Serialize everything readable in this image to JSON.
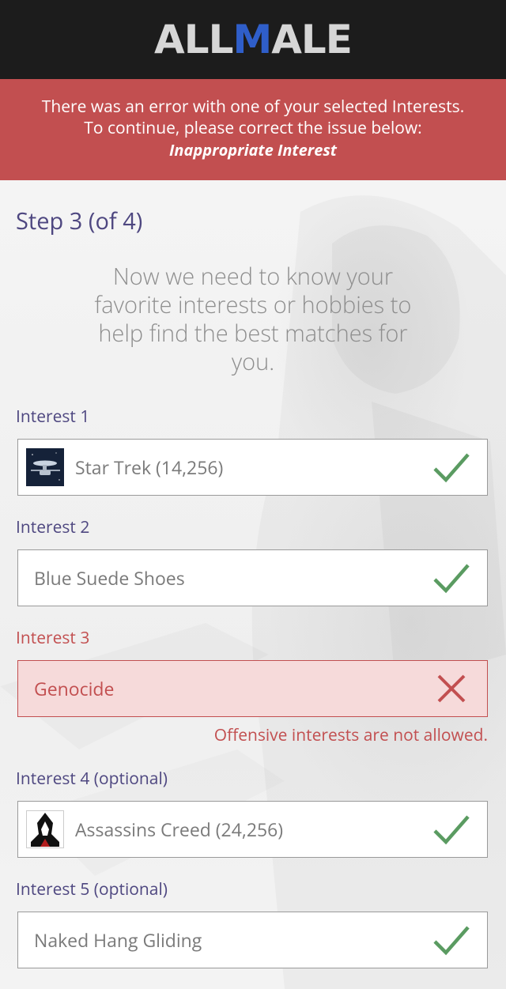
{
  "header": {
    "logo_part1": "ALL",
    "logo_part2": "M",
    "logo_part3": "ALE"
  },
  "error_banner": {
    "line1": "There was an error with one of your selected Interests.",
    "line2": "To continue, please correct the issue below:",
    "emphasis": "Inappropriate Interest"
  },
  "step": "Step 3 (of 4)",
  "intro": "Now we need to know your favorite interests or hobbies to help find the best matches for you.",
  "interests": [
    {
      "label": "Interest 1",
      "value": "Star Trek (14,256)",
      "icon": "star-trek-thumbnail",
      "status": "valid"
    },
    {
      "label": "Interest 2",
      "value": "Blue Suede Shoes",
      "status": "valid"
    },
    {
      "label": "Interest 3",
      "value": "Genocide",
      "status": "error",
      "error_message": "Offensive interests are not allowed."
    },
    {
      "label": "Interest 4 (optional)",
      "value": "Assassins Creed (24,256)",
      "icon": "assassins-creed-thumbnail",
      "status": "valid"
    },
    {
      "label": "Interest 5 (optional)",
      "value": "Naked Hang Gliding",
      "status": "valid"
    }
  ],
  "colors": {
    "header_bg": "#1c1c1c",
    "banner_bg": "#c24f50",
    "accent_purple": "#4e4780",
    "valid_green": "#5a9b61",
    "error_red": "#c24f50",
    "logo_blue": "#2f5ec9"
  }
}
